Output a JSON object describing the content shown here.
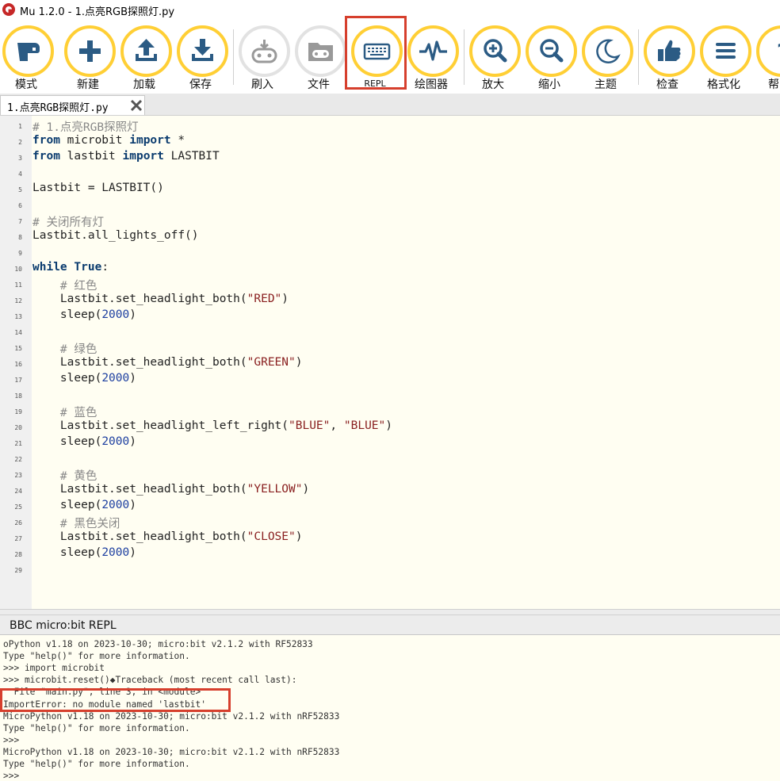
{
  "window": {
    "title": "Mu 1.2.0 - 1.点亮RGB探照灯.py"
  },
  "toolbar": {
    "buttons": [
      {
        "label": "模式",
        "icon": "mode-icon"
      },
      {
        "label": "新建",
        "icon": "plus-icon"
      },
      {
        "label": "加载",
        "icon": "upload-icon"
      },
      {
        "label": "保存",
        "icon": "download-icon"
      },
      {
        "label": "刷入",
        "icon": "flash-icon"
      },
      {
        "label": "文件",
        "icon": "files-icon"
      },
      {
        "label": "REPL",
        "icon": "keyboard-icon"
      },
      {
        "label": "绘图器",
        "icon": "plotter-icon"
      },
      {
        "label": "放大",
        "icon": "zoom-in-icon"
      },
      {
        "label": "缩小",
        "icon": "zoom-out-icon"
      },
      {
        "label": "主题",
        "icon": "moon-icon"
      },
      {
        "label": "检查",
        "icon": "thumbs-up-icon"
      },
      {
        "label": "格式化",
        "icon": "format-icon"
      },
      {
        "label": "帮",
        "icon": "help-icon"
      }
    ]
  },
  "tab": {
    "filename": "1.点亮RGB探照灯.py"
  },
  "editor": {
    "lines": [
      "# 1.点亮RGB探照灯",
      "from microbit import *",
      "from lastbit import LASTBIT",
      "",
      "Lastbit = LASTBIT()",
      "",
      "# 关闭所有灯",
      "Lastbit.all_lights_off()",
      "",
      "while True:",
      "    # 红色",
      "    Lastbit.set_headlight_both(\"RED\")",
      "    sleep(2000)",
      "",
      "    # 绿色",
      "    Lastbit.set_headlight_both(\"GREEN\")",
      "    sleep(2000)",
      "",
      "    # 蓝色",
      "    Lastbit.set_headlight_left_right(\"BLUE\", \"BLUE\")",
      "    sleep(2000)",
      "",
      "    # 黄色",
      "    Lastbit.set_headlight_both(\"YELLOW\")",
      "    sleep(2000)",
      "    # 黑色关闭",
      "    Lastbit.set_headlight_both(\"CLOSE\")",
      "    sleep(2000)",
      ""
    ]
  },
  "repl": {
    "title": "BBC micro:bit REPL",
    "lines": [
      "oPython v1.18 on 2023-10-30; micro:bit v2.1.2 with RF52833",
      "Type \"help()\" for more information.",
      ">>> import microbit",
      ">>> microbit.reset()◆Traceback (most recent call last):",
      "  File \"main.py\", line 3, in <module>",
      "ImportError: no module named 'lastbit'",
      "MicroPython v1.18 on 2023-10-30; micro:bit v2.1.2 with nRF52833",
      "Type \"help()\" for more information.",
      ">>>",
      "MicroPython v1.18 on 2023-10-30; micro:bit v2.1.2 with nRF52833",
      "Type \"help()\" for more information.",
      ">>>"
    ]
  },
  "colors": {
    "accent": "#ffcf35",
    "icon": "#2b5b84",
    "highlight": "#d63f2d",
    "disabled": "#e2e2e2"
  }
}
